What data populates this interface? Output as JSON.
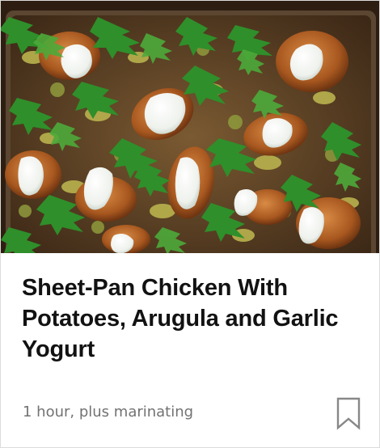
{
  "recipe": {
    "title": "Sheet-Pan Chicken With Potatoes, Arugula and Garlic Yogurt",
    "cook_time": "1 hour, plus marinating",
    "photo_icon": "recipe-photo",
    "save_icon": "bookmark-icon"
  },
  "colors": {
    "title": "#121212",
    "meta_text": "#727272",
    "bookmark_stroke": "#888888",
    "card_border": "#dcdcdc"
  }
}
